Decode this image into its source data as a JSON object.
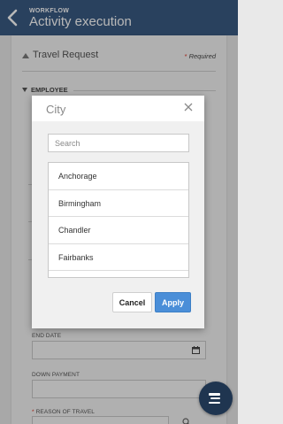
{
  "header": {
    "kicker": "WORKFLOW",
    "title": "Activity execution"
  },
  "form": {
    "section_title": "Travel Request",
    "required_label": "Required",
    "employee_label": "EMPLOYEE",
    "end_date_label": "END DATE",
    "down_payment_label": "DOWN PAYMENT",
    "reason_label": "REASON OF TRAVEL"
  },
  "modal": {
    "title": "City",
    "search_placeholder": "Search",
    "items": [
      "Anchorage",
      "Birmingham",
      "Chandler",
      "Fairbanks"
    ],
    "cancel_label": "Cancel",
    "apply_label": "Apply"
  },
  "colors": {
    "header_bg": "#3a5a83",
    "apply_bg": "#4a8ed8",
    "fab_bg": "#1f3550",
    "required_star": "#dd3322"
  },
  "icons": {
    "back": "chevron-left-icon",
    "close": "close-icon",
    "calendar": "calendar-icon",
    "search": "search-icon",
    "fab": "menu-icon"
  }
}
